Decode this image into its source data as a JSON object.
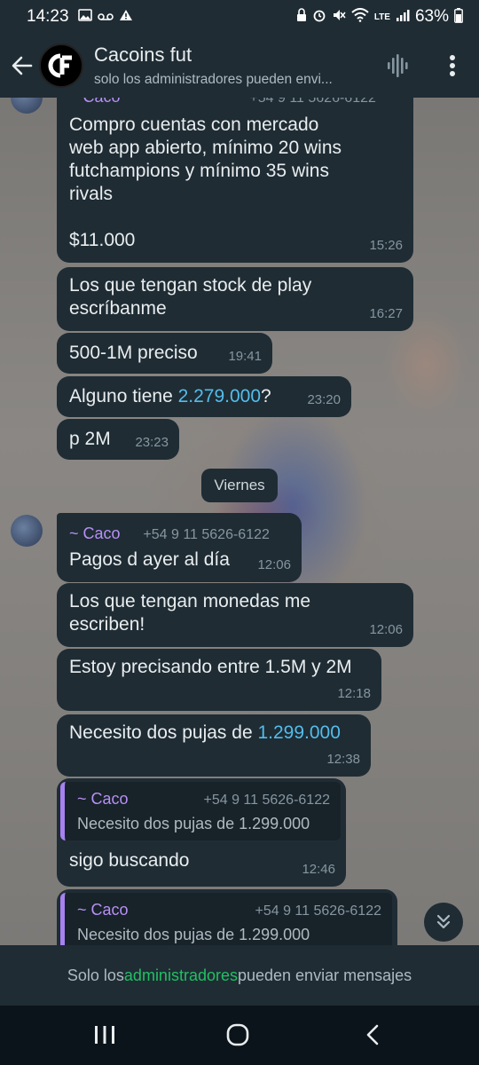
{
  "status_bar": {
    "time": "14:23",
    "battery": "63%",
    "network": "LTE"
  },
  "header": {
    "title": "Cacoins fut",
    "subtitle": "solo los administradores pueden envi..."
  },
  "messages": [
    {
      "text": "Compro cuentas con mercado\nweb app abierto, mínimo 20 wins\nfutchampions y mínimo 35 wins\nrivals\n\n$11.000",
      "time": "15:26"
    },
    {
      "text": "Los que tengan stock de play\nescríbanme",
      "time": "16:27"
    },
    {
      "text": "500-1M preciso",
      "time": "19:41"
    },
    {
      "text_before": "Alguno tiene ",
      "link": "2.279.000",
      "text_after": "?",
      "time": "23:20"
    },
    {
      "text": "p 2M",
      "time": "23:23"
    }
  ],
  "date_separator": "Viernes",
  "sender": {
    "name": "~ Caco",
    "phone": "+54 9 11 5626-6122"
  },
  "top_partial_sender": "~ Caco",
  "top_partial_phone": "+54 9 11 5626-6122",
  "messages2": [
    {
      "text": "Pagos d ayer al día",
      "time": "12:06"
    },
    {
      "text": "Los que tengan monedas me\nescriben!",
      "time": "12:06"
    },
    {
      "text": "Estoy precisando entre 1.5M y 2M",
      "time": "12:18"
    },
    {
      "text_before": "Necesito dos pujas de ",
      "link": "1.299.000",
      "time": "12:38"
    }
  ],
  "reply1": {
    "quote_sender": "~ Caco",
    "quote_phone": "+54 9 11 5626-6122",
    "quote_text": "Necesito dos pujas de 1.299.000",
    "text": "sigo buscando",
    "time": "12:46"
  },
  "reply2": {
    "quote_sender": "~ Caco",
    "quote_phone": "+54 9 11 5626-6122",
    "quote_text": "Necesito dos pujas de 1.299.000"
  },
  "footer": {
    "prefix": "Solo los ",
    "admins": "administradores",
    "suffix": " pueden enviar mensajes"
  }
}
